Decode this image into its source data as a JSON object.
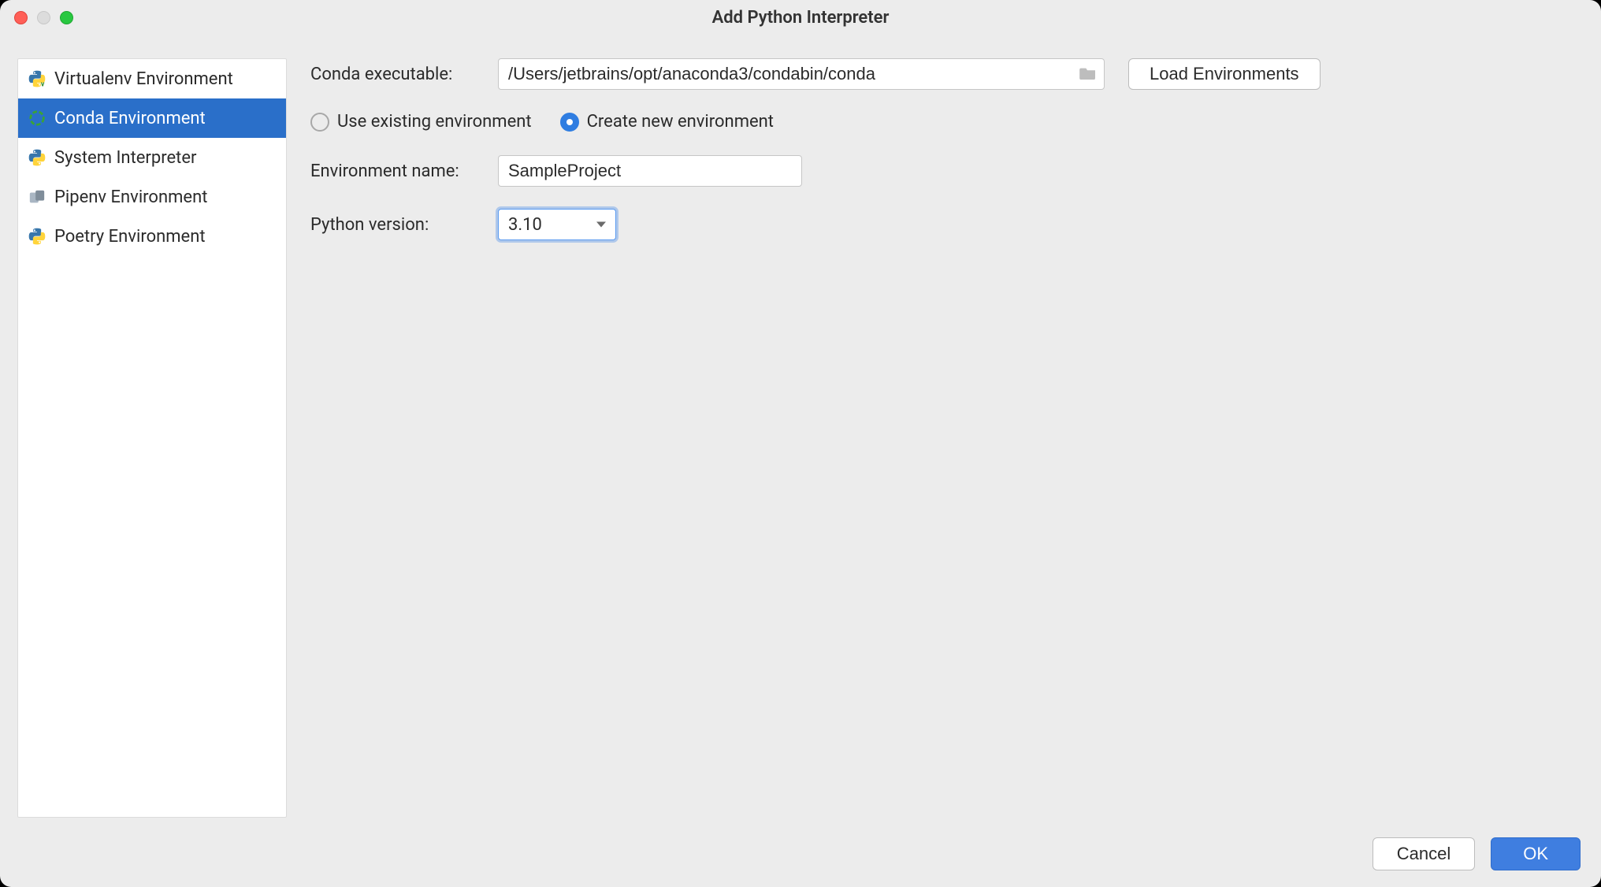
{
  "window": {
    "title": "Add Python Interpreter"
  },
  "sidebar": {
    "items": [
      {
        "label": "Virtualenv Environment",
        "icon": "python"
      },
      {
        "label": "Conda Environment",
        "icon": "conda",
        "selected": true
      },
      {
        "label": "System Interpreter",
        "icon": "python"
      },
      {
        "label": "Pipenv Environment",
        "icon": "pipenv"
      },
      {
        "label": "Poetry Environment",
        "icon": "python"
      }
    ]
  },
  "form": {
    "conda_executable_label": "Conda executable:",
    "conda_executable_value": "/Users/jetbrains/opt/anaconda3/condabin/conda",
    "load_environments_label": "Load Environments",
    "use_existing_label": "Use existing environment",
    "create_new_label": "Create new environment",
    "env_mode_selected": "create_new",
    "environment_name_label": "Environment name:",
    "environment_name_value": "SampleProject",
    "python_version_label": "Python version:",
    "python_version_value": "3.10"
  },
  "footer": {
    "cancel_label": "Cancel",
    "ok_label": "OK"
  }
}
